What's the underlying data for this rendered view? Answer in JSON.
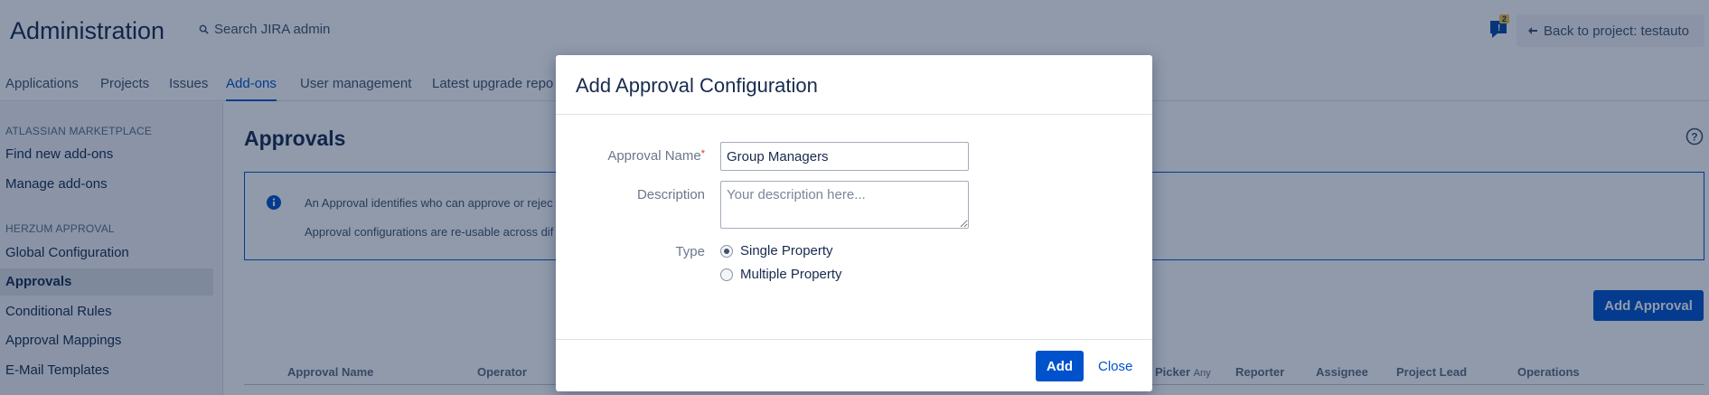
{
  "header": {
    "title": "Administration",
    "search_text": "Search JIRA admin",
    "notification_count": "2",
    "back_button": "Back to project: testauto"
  },
  "tabs": [
    "Applications",
    "Projects",
    "Issues",
    "Add-ons",
    "User management",
    "Latest upgrade repo"
  ],
  "active_tab": "Add-ons",
  "sidebar": {
    "sections": [
      {
        "heading": "ATLASSIAN MARKETPLACE",
        "items": [
          "Find new add-ons",
          "Manage add-ons"
        ]
      },
      {
        "heading": "HERZUM APPROVAL",
        "items": [
          "Global Configuration",
          "Approvals",
          "Conditional Rules",
          "Approval Mappings",
          "E-Mail Templates"
        ]
      }
    ],
    "active_item": "Approvals"
  },
  "main": {
    "title": "Approvals",
    "info_lines": [
      "An Approval identifies who can approve or rejec",
      "Approval configurations are re-usable across dif"
    ],
    "add_button": "Add Approval",
    "columns": [
      "Approval Name",
      "Operator",
      "Picker",
      "Any",
      "Reporter",
      "Assignee",
      "Project Lead",
      "Operations"
    ]
  },
  "dialog": {
    "title": "Add Approval Configuration",
    "name_label": "Approval Name",
    "required_marker": "*",
    "name_value": "Group Managers",
    "description_label": "Description",
    "description_placeholder": "Your description here...",
    "type_label": "Type",
    "type_options": [
      "Single Property",
      "Multiple Property"
    ],
    "type_selected": "Single Property",
    "add_button": "Add",
    "close_link": "Close"
  },
  "colors": {
    "primary": "#0052cc",
    "text": "#172b4d",
    "overlay": "#091e42"
  }
}
